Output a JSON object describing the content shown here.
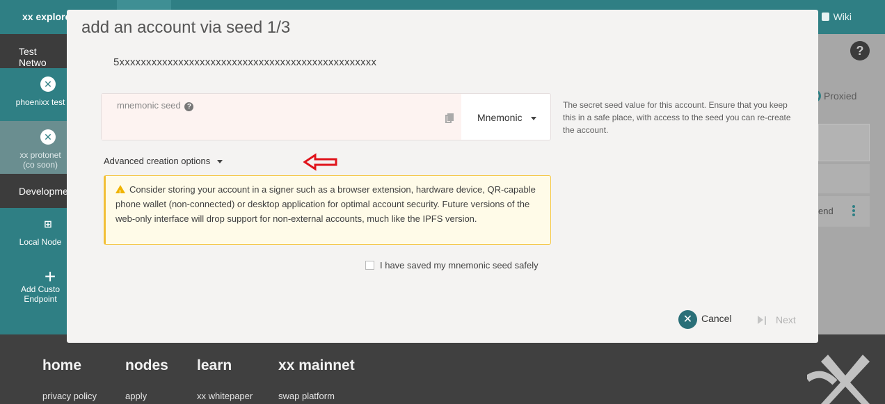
{
  "app": {
    "brand": "xx explore",
    "top_tab": "...",
    "wiki": "Wiki"
  },
  "sidebar": {
    "sections": [
      {
        "label": "Test Netwo"
      },
      {
        "label": "Developme"
      }
    ],
    "items": [
      {
        "label": "phoenixx test"
      },
      {
        "label": "xx protonet (co soon)"
      },
      {
        "label": "Local Node"
      },
      {
        "label": "Add Custo Endpoint"
      }
    ]
  },
  "background": {
    "proxied": "Proxied",
    "row_text": "end"
  },
  "modal": {
    "title": "add an account via seed 1/3",
    "address": "5xxxxxxxxxxxxxxxxxxxxxxxxxxxxxxxxxxxxxxxxxxxxxxxx",
    "seed_label": "mnemonic seed",
    "seed_type": "Mnemonic",
    "help_text": "The secret seed value for this account. Ensure that you keep this in a safe place, with access to the seed you can re-create the account.",
    "advanced": "Advanced creation options",
    "warning": "Consider storing your account in a signer such as a browser extension, hardware device, QR-capable phone wallet (non-connected) or desktop application for optimal account security. Future versions of the web-only interface will drop support for non-external accounts, much like the IPFS version.",
    "checkbox_label": "I have saved my mnemonic seed safely",
    "cancel": "Cancel",
    "next": "Next"
  },
  "footer": {
    "columns": [
      {
        "heading": "home",
        "link": "privacy policy"
      },
      {
        "heading": "nodes",
        "link": "apply"
      },
      {
        "heading": "learn",
        "link": "xx whitepaper"
      },
      {
        "heading": "xx mainnet",
        "link": "swap platform"
      }
    ]
  },
  "colors": {
    "teal": "#2f7f84",
    "warning_border": "#f5c84a",
    "warning_bg": "#fffbe8",
    "arrow": "#e0141c"
  }
}
